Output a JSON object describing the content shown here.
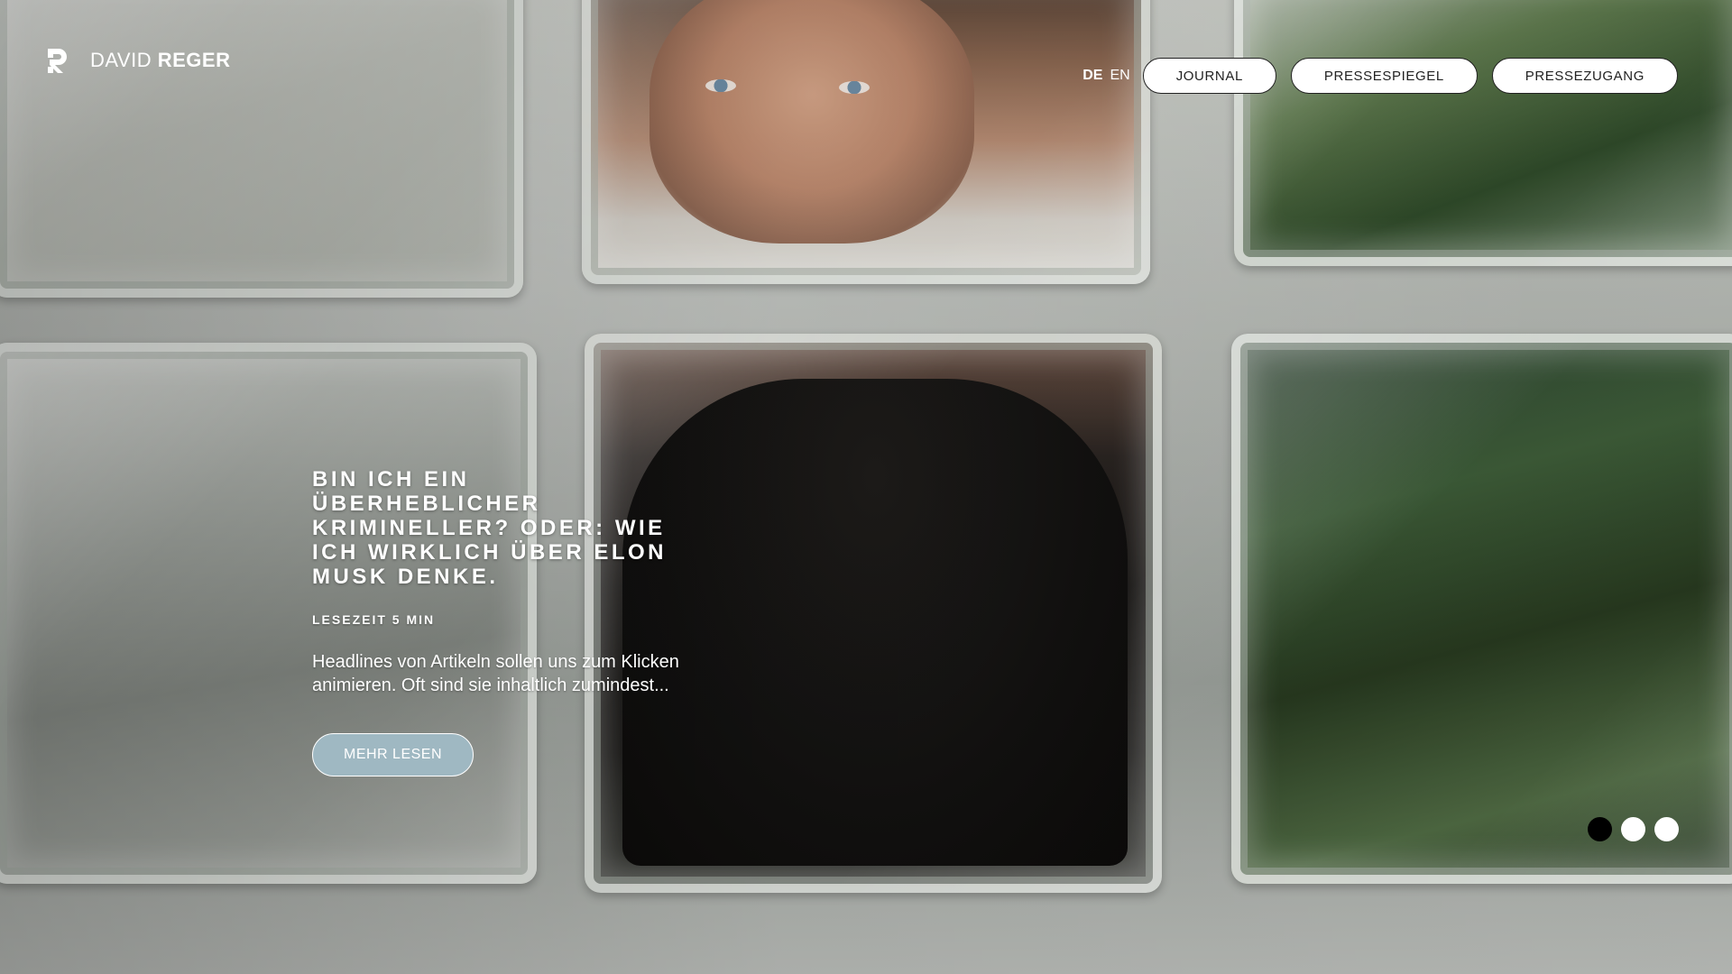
{
  "brand": {
    "first": "DAVID",
    "last": "REGER"
  },
  "nav": {
    "lang_de": "DE",
    "lang_en": "EN",
    "items": [
      {
        "label": "JOURNAL"
      },
      {
        "label": "PRESSESPIEGEL"
      },
      {
        "label": "PRESSEZUGANG"
      }
    ]
  },
  "hero": {
    "headline": "BIN ICH EIN ÜBERHEBLICHER KRIMINELLER? ODER: WIE ICH WIRKLICH ÜBER ELON MUSK DENKE.",
    "read_time": "LESEZEIT 5 MIN",
    "excerpt": "Headlines von Artikeln sollen uns zum Klicken animieren. Oft sind sie inhaltlich zumindest...",
    "cta_label": "MEHR LESEN"
  },
  "slider": {
    "active_index": 0,
    "count": 3
  },
  "colors": {
    "cta_bg": "#9fb8c2",
    "dot_active": "#000000",
    "dot_inactive": "#ffffff"
  },
  "icons": {
    "logo": "dr-monogram-icon"
  }
}
